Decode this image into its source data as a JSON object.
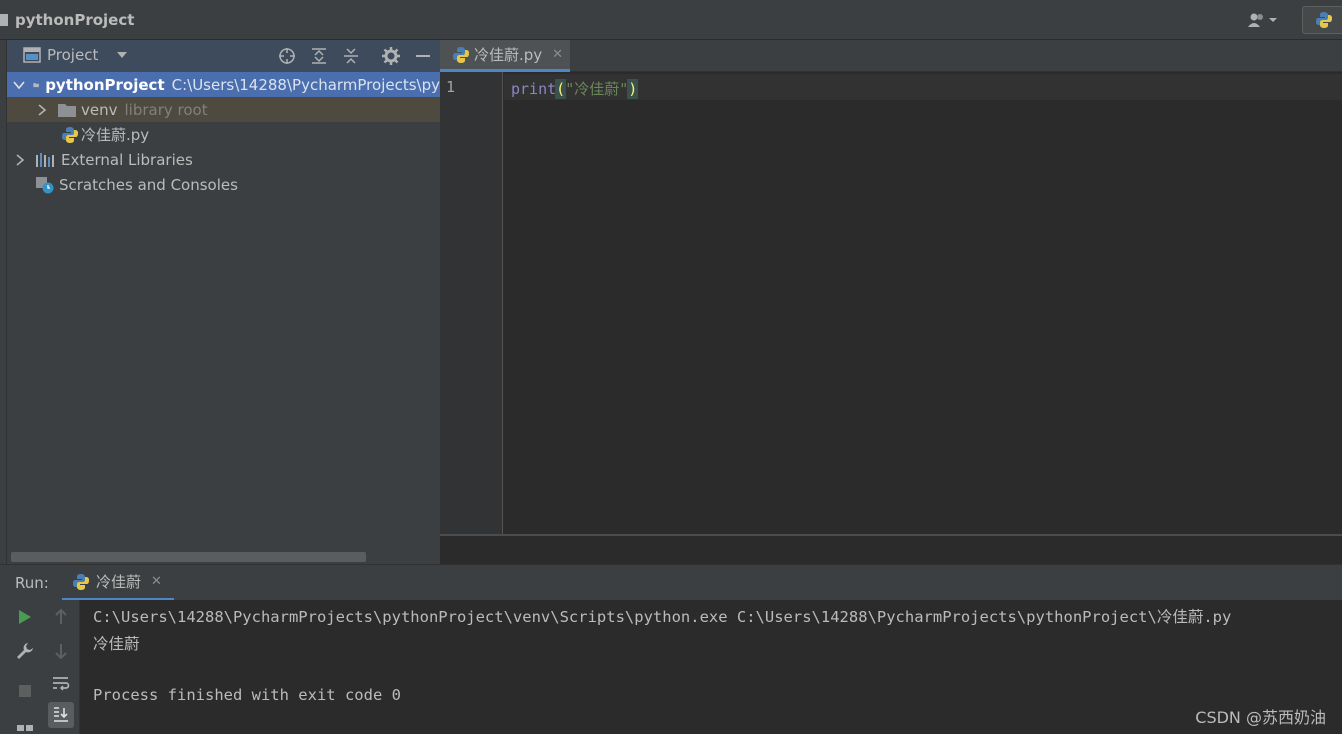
{
  "titlebar": {
    "project_name": "pythonProject"
  },
  "project_panel": {
    "title": "Project",
    "tree": [
      {
        "label": "pythonProject",
        "extra": "C:\\Users\\14288\\PycharmProjects\\py"
      },
      {
        "label": "venv",
        "extra": "library root"
      },
      {
        "label": "冷佳蔚.py"
      },
      {
        "label": "External Libraries"
      },
      {
        "label": "Scratches and Consoles"
      }
    ]
  },
  "editor": {
    "tab_label": "冷佳蔚.py",
    "line_number": "1",
    "code": {
      "function": "print",
      "open_paren": "(",
      "string": "\"冷佳蔚\"",
      "close_paren": ")"
    }
  },
  "run": {
    "label": "Run:",
    "tab_label": "冷佳蔚",
    "console_lines": [
      "C:\\Users\\14288\\PycharmProjects\\pythonProject\\venv\\Scripts\\python.exe C:\\Users\\14288\\PycharmProjects\\pythonProject\\冷佳蔚.py",
      "冷佳蔚",
      "",
      "Process finished with exit code 0"
    ],
    "watermark": "CSDN @苏西奶油"
  },
  "colors": {
    "accent": "#4a88c7",
    "selection": "#4b6eaf",
    "run_green": "#499c54",
    "string": "#6a8759",
    "builtin": "#8888c6"
  }
}
